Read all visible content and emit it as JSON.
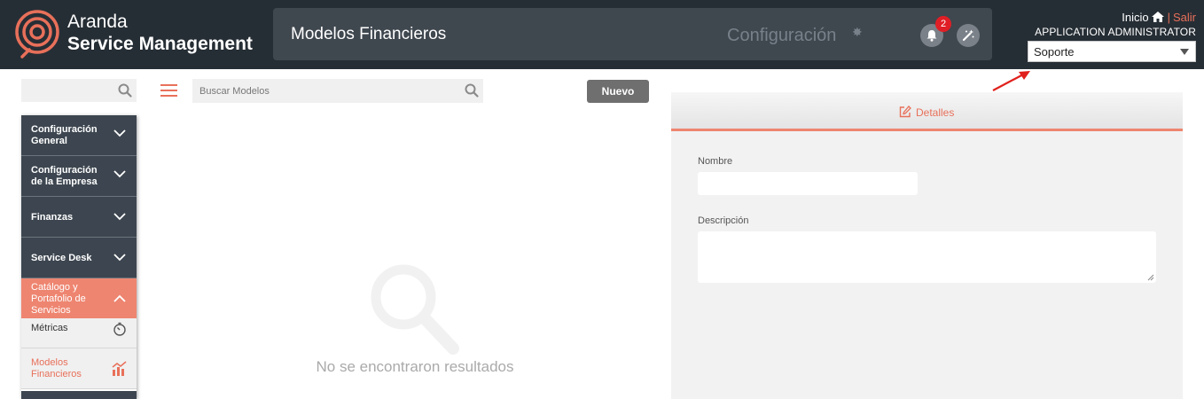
{
  "header": {
    "brand_line1": "Aranda",
    "brand_line2": "Service Management",
    "page_title": "Modelos Financieros",
    "section_label": "Configuración",
    "notification_count": "2",
    "links": {
      "inicio": "Inicio",
      "separator": "|",
      "salir": "Salir"
    },
    "user_name": "APPLICATION ADMINISTRATOR",
    "role_selected": "Soporte"
  },
  "sidebar": {
    "items": [
      {
        "label": "Configuración General"
      },
      {
        "label": "Configuración de la Empresa"
      },
      {
        "label": "Finanzas"
      },
      {
        "label": "Service Desk"
      },
      {
        "label": "Catálogo y Portafolio de Servicios"
      }
    ],
    "subitems": [
      {
        "label": "Métricas"
      },
      {
        "label": "Modelos Financieros"
      }
    ]
  },
  "list": {
    "search_placeholder": "Buscar Modelos",
    "new_button": "Nuevo",
    "empty_message": "No se encontraron resultados"
  },
  "detail": {
    "tab_label": "Detalles",
    "fields": {
      "name_label": "Nombre",
      "description_label": "Descripción"
    }
  },
  "colors": {
    "accent": "#ee8570",
    "header_bg": "#262e35",
    "nav_bg": "#3d4650",
    "badge": "#e01e25"
  }
}
